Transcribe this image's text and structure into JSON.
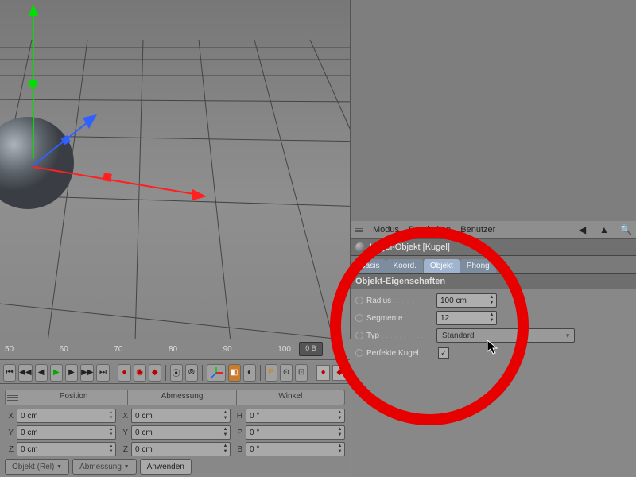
{
  "viewport": {
    "grid_color": "#555",
    "sphere_color": "#6b7078"
  },
  "timeline": {
    "ticks": [
      "50",
      "60",
      "70",
      "80",
      "90",
      "100"
    ],
    "frame_field": "0 B"
  },
  "transport": {
    "record_circle": "●",
    "record_diamond": "◆"
  },
  "coords": {
    "headers": {
      "position": "Position",
      "dimension": "Abmessung",
      "angle": "Winkel"
    },
    "rows": [
      {
        "axis": "X",
        "pos": "0 cm",
        "dim": "0 cm",
        "ang_label": "H",
        "ang": "0 °"
      },
      {
        "axis": "Y",
        "pos": "0 cm",
        "dim": "0 cm",
        "ang_label": "P",
        "ang": "0 °"
      },
      {
        "axis": "Z",
        "pos": "0 cm",
        "dim": "0 cm",
        "ang_label": "B",
        "ang": "0 °"
      }
    ],
    "buttons": {
      "mode": "Objekt (Rel)",
      "dim_mode": "Abmessung",
      "apply": "Anwenden"
    }
  },
  "attr": {
    "menu": {
      "modus": "Modus",
      "bearbeiten": "Bearbeiten",
      "benutzer": "Benutzer"
    },
    "object_title": "Kugel-Objekt [Kugel]",
    "tabs": {
      "basis": "Basis",
      "koord": "Koord.",
      "objekt": "Objekt",
      "phong": "Phong"
    },
    "section": "Objekt-Eigenschaften",
    "props": {
      "radius": {
        "label": "Radius",
        "value": "100 cm"
      },
      "segmente": {
        "label": "Segmente",
        "value": "12"
      },
      "typ": {
        "label": "Typ",
        "value": "Standard"
      },
      "perfekte": {
        "label": "Perfekte Kugel",
        "checked": "✓"
      }
    }
  }
}
